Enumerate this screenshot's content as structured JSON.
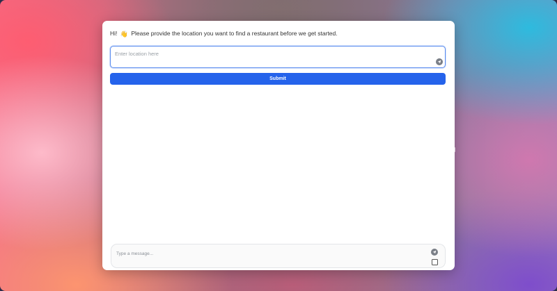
{
  "greeting": {
    "before_icon": "Hi!",
    "icon": "waving-hand-icon",
    "icon_glyph": "👋",
    "message": "Please provide the location you want to find a restaurant before we get started."
  },
  "location": {
    "placeholder": "Enter location here",
    "value": "",
    "action_icon": "send-icon"
  },
  "submit": {
    "label": "Submit"
  },
  "chat": {
    "placeholder": "Type a message...",
    "value": "",
    "action_icon": "send-icon"
  },
  "colors": {
    "accent": "#2563eb",
    "input_focus_border": "#5b8def",
    "icon_button": "#7a7f87"
  }
}
